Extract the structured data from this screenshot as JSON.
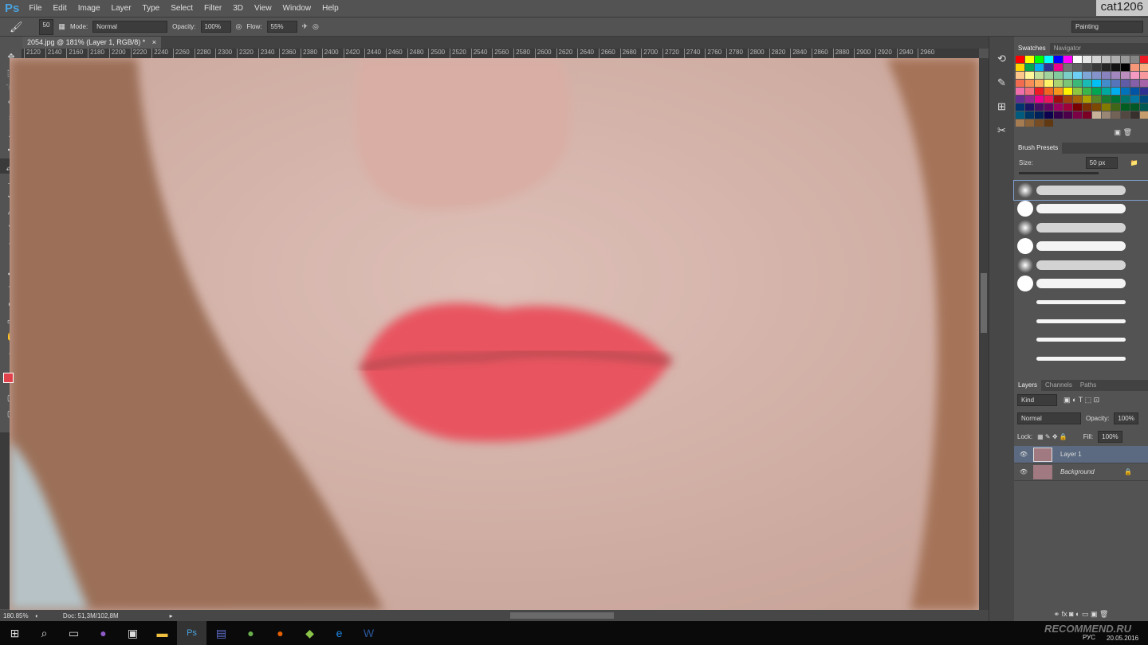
{
  "app": {
    "logo": "Ps",
    "user": "cat1206"
  },
  "menu": [
    "File",
    "Edit",
    "Image",
    "Layer",
    "Type",
    "Select",
    "Filter",
    "3D",
    "View",
    "Window",
    "Help"
  ],
  "options": {
    "brush_size": "50",
    "mode_label": "Mode:",
    "mode": "Normal",
    "opacity_label": "Opacity:",
    "opacity": "100%",
    "flow_label": "Flow:",
    "flow": "55%",
    "workspace": "Painting"
  },
  "document": {
    "tab": "2054.jpg @ 181% (Layer 1, RGB/8) *",
    "close": "×"
  },
  "ruler": [
    "2120",
    "2140",
    "2160",
    "2180",
    "2200",
    "2220",
    "2240",
    "2260",
    "2280",
    "2300",
    "2320",
    "2340",
    "2360",
    "2380",
    "2400",
    "2420",
    "2440",
    "2460",
    "2480",
    "2500",
    "2520",
    "2540",
    "2560",
    "2580",
    "2600",
    "2620",
    "2640",
    "2660",
    "2680",
    "2700",
    "2720",
    "2740",
    "2760",
    "2780",
    "2800",
    "2820",
    "2840",
    "2860",
    "2880",
    "2900",
    "2920",
    "2940",
    "2960"
  ],
  "status": {
    "zoom": "180.85%",
    "doc": "Doc: 51,3M/102,8M"
  },
  "colors": {
    "foreground": "#e0414a",
    "background": "#d99a9a",
    "lips": "#e85560"
  },
  "swatches": {
    "tabs": [
      "Swatches",
      "Navigator"
    ],
    "colors": [
      "#ff0000",
      "#ffff00",
      "#00ff00",
      "#00ffff",
      "#0000ff",
      "#ff00ff",
      "#ffffff",
      "#e6e6e6",
      "#d3d3d3",
      "#c0c0c0",
      "#adadad",
      "#999999",
      "#858585",
      "#ed1c24",
      "#ffd400",
      "#00a650",
      "#00aeef",
      "#2e3192",
      "#ec008c",
      "#737373",
      "#606060",
      "#4d4d4d",
      "#393939",
      "#262626",
      "#131313",
      "#000000",
      "#f7977a",
      "#f9ad81",
      "#fdc68a",
      "#fff79a",
      "#c4df9b",
      "#a3d39c",
      "#82ca9d",
      "#7bcdc8",
      "#6ecff6",
      "#7ea7d8",
      "#8493ca",
      "#8882be",
      "#a187be",
      "#bc8dbf",
      "#f49ac2",
      "#f6989d",
      "#f26c4f",
      "#f68e55",
      "#fbaf5c",
      "#fff467",
      "#acd372",
      "#7cc576",
      "#3bb878",
      "#1abbb4",
      "#00bff3",
      "#438ccb",
      "#5574b9",
      "#605ca8",
      "#855fa8",
      "#a763a8",
      "#f06eaa",
      "#f26d7d",
      "#ed1c24",
      "#f26522",
      "#f7941d",
      "#fff200",
      "#8dc63f",
      "#39b54a",
      "#00a651",
      "#00a99d",
      "#00aeef",
      "#0072bc",
      "#0054a6",
      "#2e3192",
      "#662d91",
      "#92278f",
      "#ec008c",
      "#ed145b",
      "#9e0b0f",
      "#a0410d",
      "#a36209",
      "#aba000",
      "#598527",
      "#1a7b30",
      "#007236",
      "#00746b",
      "#0076a3",
      "#004b80",
      "#003471",
      "#1b1464",
      "#440e62",
      "#630460",
      "#9e005d",
      "#9e0039",
      "#790000",
      "#7b2e00",
      "#7d4900",
      "#827b00",
      "#406618",
      "#005e20",
      "#005826",
      "#005952",
      "#005b7f",
      "#003663",
      "#002157",
      "#0d004c",
      "#32004b",
      "#4b0049",
      "#7b0046",
      "#7a0026",
      "#c7b299",
      "#998675",
      "#736357",
      "#534741",
      "#37302d",
      "#c69c6d",
      "#a67c52",
      "#8c6239",
      "#754c24",
      "#603913"
    ]
  },
  "brush_presets": {
    "title": "Brush Presets",
    "size_label": "Size:",
    "size": "50 px"
  },
  "layers": {
    "tabs": [
      "Layers",
      "Channels",
      "Paths"
    ],
    "kind": "Kind",
    "blend": "Normal",
    "opacity_label": "Opacity:",
    "opacity": "100%",
    "lock_label": "Lock:",
    "fill_label": "Fill:",
    "fill": "100%",
    "items": [
      {
        "name": "Layer 1",
        "selected": true
      },
      {
        "name": "Background",
        "locked": true
      }
    ]
  },
  "tray": {
    "watermark": "RECOMMEND.RU",
    "lang": "РУС",
    "date": "20.05.2016"
  }
}
